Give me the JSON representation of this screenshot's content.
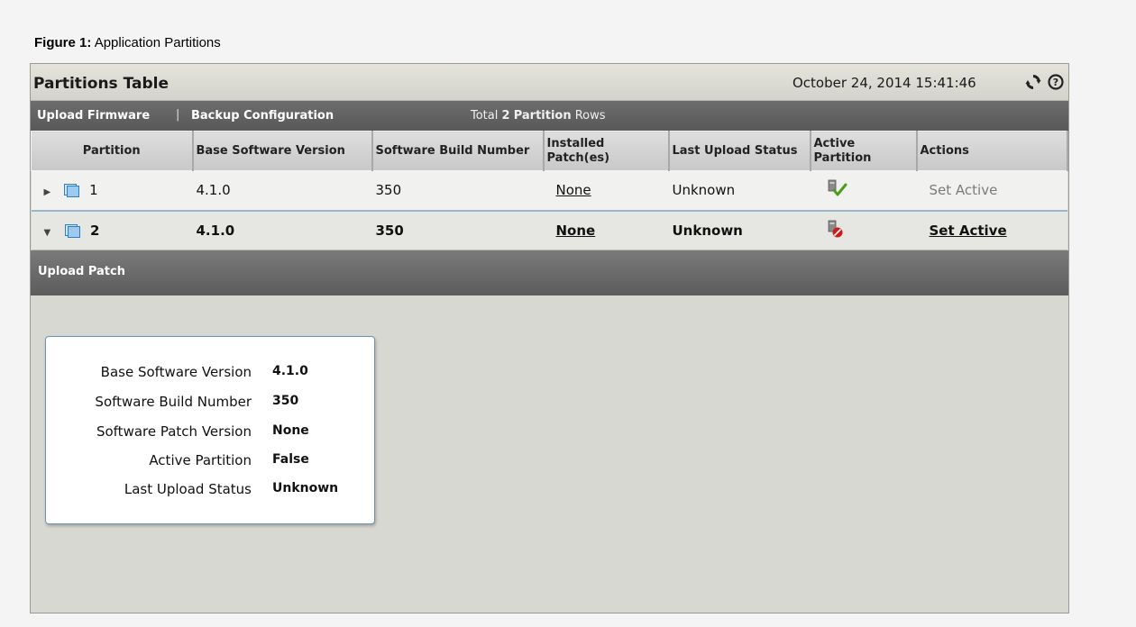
{
  "caption": {
    "label": "Figure 1:",
    "text": "Application Partitions"
  },
  "header": {
    "title": "Partitions Table",
    "timestamp": "October 24, 2014 15:41:46",
    "refresh_icon": "refresh-icon",
    "help_icon": "help-icon"
  },
  "toolbar": {
    "upload_firmware": "Upload Firmware",
    "separator": "|",
    "backup_configuration": "Backup Configuration",
    "total_prefix": "Total",
    "total_count": "2",
    "total_word": "Partition",
    "total_suffix": "Rows"
  },
  "columns": {
    "partition": "Partition",
    "base_software_version": "Base Software Version",
    "software_build_number": "Software Build Number",
    "installed_patches": "Installed Patch(es)",
    "last_upload_status": "Last Upload Status",
    "active_partition": "Active Partition",
    "actions": "Actions"
  },
  "rows": [
    {
      "expander": "▶",
      "partition": "1",
      "base_software_version": "4.1.0",
      "software_build_number": "350",
      "installed_patches": "None",
      "last_upload_status": "Unknown",
      "active_icon": "active-check-icon",
      "action": "Set Active"
    },
    {
      "expander": "▼",
      "partition": "2",
      "base_software_version": "4.1.0",
      "software_build_number": "350",
      "installed_patches": "None",
      "last_upload_status": "Unknown",
      "active_icon": "inactive-forbidden-icon",
      "action": "Set Active"
    }
  ],
  "detail": {
    "section_title": "Upload Patch",
    "fields": [
      {
        "label": "Base Software Version",
        "value": "4.1.0"
      },
      {
        "label": "Software Build Number",
        "value": "350"
      },
      {
        "label": "Software Patch Version",
        "value": "None"
      },
      {
        "label": "Active Partition",
        "value": "False"
      },
      {
        "label": "Last Upload Status",
        "value": "Unknown"
      }
    ]
  },
  "colors": {
    "titlebar_bg": "#dcdcd4",
    "toolbar_bg": "#636363",
    "frame_bg": "#d8d8d2",
    "card_border": "#6e93b4",
    "check_green": "#4a9d1c",
    "forbidden_red": "#d01818"
  }
}
